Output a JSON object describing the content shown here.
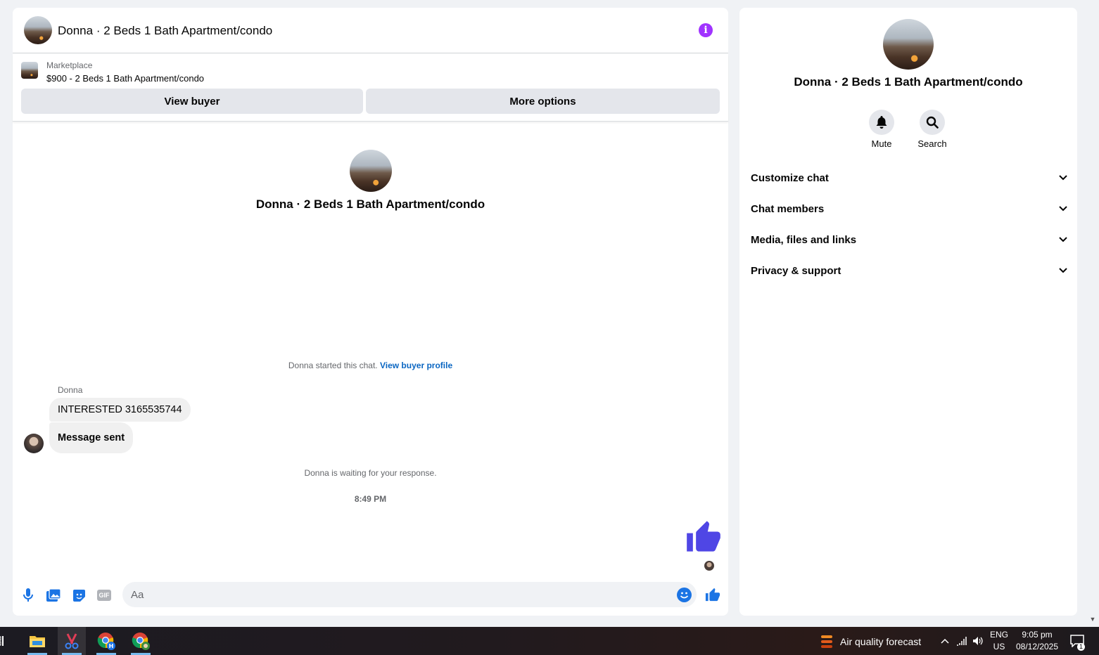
{
  "chat": {
    "header_title": "Donna · 2 Beds 1 Bath Apartment/condo",
    "info_icon": "i",
    "marketplace": {
      "label": "Marketplace",
      "listing": "$900 - 2 Beds 1 Bath Apartment/condo",
      "view_buyer": "View buyer",
      "more_options": "More options"
    },
    "intro_title": "Donna · 2 Beds 1 Bath Apartment/condo",
    "started_text": "Donna started this chat.",
    "view_profile_link": "View buyer profile",
    "sender_name": "Donna",
    "messages": [
      {
        "text": "INTERESTED 3165535744"
      },
      {
        "text": "Message sent"
      }
    ],
    "waiting_text": "Donna is waiting for your response.",
    "timestamp": "8:49 PM",
    "composer": {
      "placeholder": "Aa",
      "icons": [
        "microphone-icon",
        "photo-icon",
        "sticker-icon",
        "gif-icon",
        "emoji-icon",
        "thumbs-up-icon"
      ],
      "gif_label": "GIF"
    },
    "accent_color": "#0a66c2",
    "like_color": "#4f46e5"
  },
  "info_panel": {
    "title": "Donna · 2 Beds 1 Bath Apartment/condo",
    "actions": {
      "mute": "Mute",
      "search": "Search"
    },
    "sections": [
      {
        "label": "Customize chat"
      },
      {
        "label": "Chat members"
      },
      {
        "label": "Media, files and links"
      },
      {
        "label": "Privacy & support"
      }
    ]
  },
  "taskbar": {
    "air_quality": "Air quality forecast",
    "language_top": "ENG",
    "language_bottom": "US",
    "time": "9:05 pm",
    "date": "08/12/2025",
    "notification_count": "1"
  }
}
